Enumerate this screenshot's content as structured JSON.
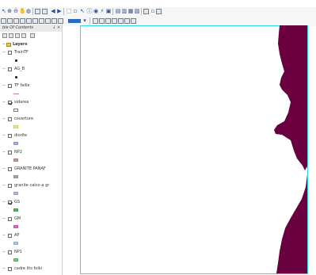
{
  "toc": {
    "title": "ble Of Contents",
    "pin": "↓",
    "close": "×"
  },
  "layers": [
    {
      "name": "Layers",
      "checked": false,
      "symbol": "folder",
      "bold": true
    },
    {
      "name": "TrainTF",
      "checked": false,
      "symbol": "dot"
    },
    {
      "name": "AG_B",
      "checked": false,
      "symbol": "dot"
    },
    {
      "name": "TF faille",
      "checked": false,
      "symbol": "line"
    },
    {
      "name": "sidarea",
      "checked": true,
      "symbol": "box-white"
    },
    {
      "name": "coverture",
      "checked": false,
      "symbol": "box-yellow"
    },
    {
      "name": "diorite",
      "checked": false,
      "symbol": "box-blue"
    },
    {
      "name": "NP2",
      "checked": false,
      "symbol": "box-pink"
    },
    {
      "name": "GRANITE PANAF",
      "checked": false,
      "symbol": "box-grey"
    },
    {
      "name": "granite calco-a gr",
      "checked": false,
      "symbol": "box-purple"
    },
    {
      "name": "GS",
      "checked": true,
      "symbol": "box-green"
    },
    {
      "name": "GM",
      "checked": false,
      "symbol": "box-magenta"
    },
    {
      "name": "AP",
      "checked": false,
      "symbol": "box-lightblue"
    },
    {
      "name": "NP1",
      "checked": false,
      "symbol": "box-lime"
    },
    {
      "name": "cadre lits folki",
      "checked": false,
      "symbol": "box-red"
    }
  ],
  "colors": {
    "map_polygon": "#6b0041",
    "map_border": "#2fd9ec",
    "accent": "#2f67c4"
  }
}
